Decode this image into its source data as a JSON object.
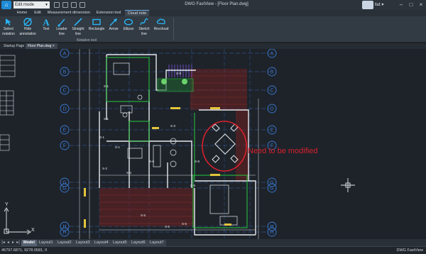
{
  "titlebar": {
    "mode_select": "Edit mode",
    "window_title": "DWG FastView - [Floor Plan.dwg]",
    "user_name": "liut ▾"
  },
  "ribbon": {
    "tabs": [
      {
        "label": "Home"
      },
      {
        "label": "Edit"
      },
      {
        "label": "Measurement dimension"
      },
      {
        "label": "Extension tool"
      },
      {
        "label": "Cloud note"
      }
    ],
    "active_tab": "Cloud note",
    "tools": [
      {
        "label1": "Select",
        "label2": "notation",
        "icon": "select-notation-icon"
      },
      {
        "label1": "Hide",
        "label2": "annotation",
        "icon": "hide-annotation-icon"
      },
      {
        "label1": "Text",
        "label2": "",
        "icon": "text-icon"
      },
      {
        "label1": "Leader",
        "label2": "line",
        "icon": "leader-line-icon"
      },
      {
        "label1": "Straight",
        "label2": "line",
        "icon": "straight-line-icon"
      },
      {
        "label1": "Rectangle",
        "label2": "",
        "icon": "rectangle-icon"
      },
      {
        "label1": "Arrow",
        "label2": "",
        "icon": "arrow-icon"
      },
      {
        "label1": "Ellipse",
        "label2": "",
        "icon": "ellipse-icon"
      },
      {
        "label1": "Sketch",
        "label2": "line",
        "icon": "sketch-line-icon"
      },
      {
        "label1": "Revcloud",
        "label2": "",
        "icon": "revcloud-icon"
      }
    ],
    "group_label": "Notation tool",
    "icon_color": "#29b6f6"
  },
  "doc_tabs": [
    {
      "label": "Startup Page"
    },
    {
      "label": "Floor Plan.dwg ×"
    }
  ],
  "canvas": {
    "annotation_text": "Need to be modified",
    "annotation_color": "#d8202c",
    "axis_labels_left": [
      "A",
      "B",
      "C",
      "D",
      "E",
      "F",
      "G",
      "H"
    ],
    "axis_labels_right": [
      "A",
      "B",
      "C",
      "D",
      "E",
      "F",
      "G",
      "H"
    ],
    "room_labels": [
      "S-1",
      "S-1",
      "S-2",
      "S-3",
      "S-4",
      "S-5",
      "S-5",
      "S-5",
      "S-6",
      "S-6",
      "S-8",
      "S-9",
      "S-1",
      "S-1"
    ],
    "ucs_x_label": "X",
    "ucs_y_label": "Y"
  },
  "layout_tabs": [
    {
      "label": "Model"
    },
    {
      "label": "Layout1"
    },
    {
      "label": "Layout2"
    },
    {
      "label": "Layout3"
    },
    {
      "label": "Layout4"
    },
    {
      "label": "Layout5"
    },
    {
      "label": "Layout6"
    },
    {
      "label": "Layout7"
    }
  ],
  "status": {
    "coordinates": "46797.6871, 9278.0581, 0",
    "app_name": "DWG FastView"
  }
}
